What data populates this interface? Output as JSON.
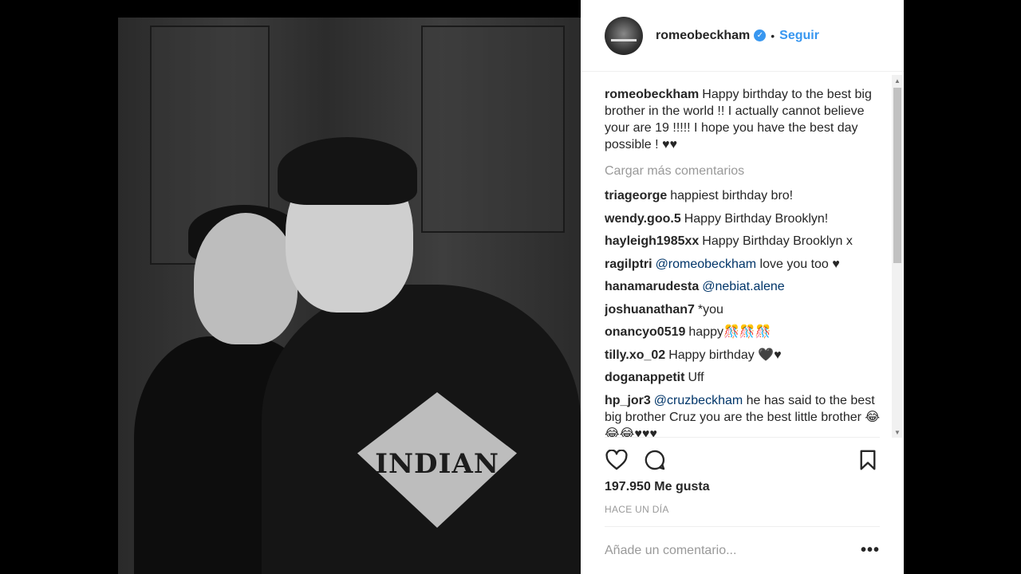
{
  "post": {
    "username": "romeobeckham",
    "follow_label": "Seguir",
    "separator": "•",
    "shirt_text": "INDIAN"
  },
  "caption": {
    "username": "romeobeckham",
    "text": "Happy birthday to the best big brother in the world !! I actually cannot believe your are 19 !!!!! I hope you have the best day possible ! ♥♥"
  },
  "load_more": "Cargar más comentarios",
  "comments": [
    {
      "username": "triageorge",
      "text": "happiest birthday bro!",
      "mention": ""
    },
    {
      "username": "wendy.goo.5",
      "text": "Happy Birthday Brooklyn!",
      "mention": ""
    },
    {
      "username": "hayleigh1985xx",
      "text": "Happy Birthday Brooklyn x",
      "mention": ""
    },
    {
      "username": "ragilptri",
      "mention": "@romeobeckham",
      "text": "love you too ♥"
    },
    {
      "username": "hanamarudesta",
      "mention": "@nebiat.alene",
      "text": ""
    },
    {
      "username": "joshuanathan7",
      "text": "*you",
      "mention": ""
    },
    {
      "username": "onancyo0519",
      "text": "happy🎊🎊🎊",
      "mention": ""
    },
    {
      "username": "tilly.xo_02",
      "text": "Happy birthday 🖤♥",
      "mention": ""
    },
    {
      "username": "doganappetit",
      "text": "Uff",
      "mention": ""
    },
    {
      "username": "hp_jor3",
      "mention": "@cruzbeckham",
      "text": "he has said to the best big brother Cruz you are the best little brother 😂😂😂♥♥♥"
    }
  ],
  "likes": "197.950 Me gusta",
  "timestamp": "HACE UN DÍA",
  "add_comment": {
    "placeholder": "Añade un comentario..."
  },
  "more_label": "•••",
  "icons": {
    "like": "heart-icon",
    "comment": "comment-icon",
    "save": "bookmark-icon",
    "verified": "verified-badge-icon"
  }
}
